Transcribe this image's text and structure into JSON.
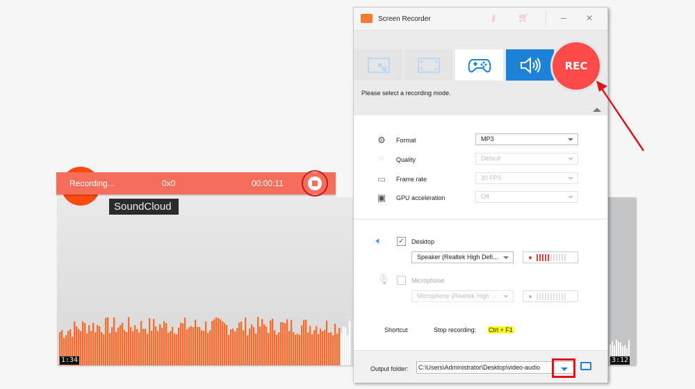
{
  "background_player": {
    "site_label": "SoundCloud",
    "elapsed_time": "1:34",
    "total_time": "3:12",
    "waveform_color": "#ff6a2b",
    "waveform_played_fraction": 0.5
  },
  "recording_bar": {
    "status": "Recording...",
    "resolution": "0x0",
    "timer": "00:00:11",
    "stop_label": "Stop"
  },
  "window": {
    "title": "Screen Recorder",
    "icons": [
      "key-icon",
      "cart-icon"
    ],
    "minimize_label": "–",
    "close_label": "✕"
  },
  "modes": {
    "items": [
      {
        "name": "region",
        "label": "Region"
      },
      {
        "name": "fullscreen",
        "label": "Fullscreen"
      },
      {
        "name": "game",
        "label": "Game"
      },
      {
        "name": "audio",
        "label": "Audio only",
        "active": true
      }
    ],
    "rec_label": "REC",
    "hint": "Please select a recording mode."
  },
  "settings": {
    "format": {
      "label": "Format",
      "value": "MP3"
    },
    "quality": {
      "label": "Quality",
      "value": "Default"
    },
    "frame_rate": {
      "label": "Frame rate",
      "value": "30 FPS"
    },
    "gpu": {
      "label": "GPU acceleration",
      "value": "Off"
    }
  },
  "audio": {
    "desktop": {
      "label": "Desktop",
      "checked": true,
      "device": "Speaker (Realtek High Defi...",
      "level_bars_active": 5,
      "level_bars_total": 11
    },
    "microphone": {
      "label": "Microphone",
      "checked": false,
      "device": "Microphone (Realtek High ...",
      "level_bars_active": 0,
      "level_bars_total": 11
    }
  },
  "shortcut": {
    "label": "Shortcut",
    "action": "Stop recording:",
    "keys": "Ctrl + F1"
  },
  "output": {
    "label": "Output folder:",
    "path": "C:\\Users\\Administrator\\Desktop\\video-audio"
  },
  "colors": {
    "accent": "#1b82d8",
    "rec": "#ff4a4a",
    "recording_bar": "#f46e5b",
    "annotation": "#e0141c"
  }
}
